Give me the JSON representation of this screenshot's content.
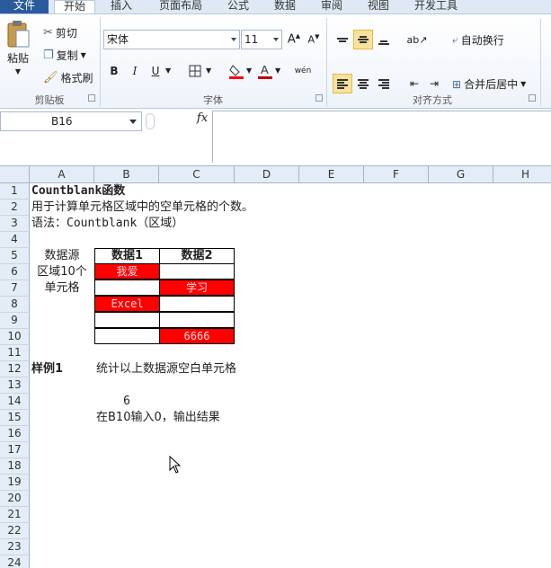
{
  "tabs": [
    "文件",
    "开始",
    "插入",
    "页面布局",
    "公式",
    "数据",
    "审阅",
    "视图",
    "开发工具"
  ],
  "clipboard": {
    "paste": "粘贴",
    "cut": "剪切",
    "copy": "复制",
    "format_painter": "格式刷",
    "group": "剪贴板"
  },
  "font": {
    "name": "宋体",
    "size": "11",
    "bold": "B",
    "italic": "I",
    "underline": "U",
    "group": "字体"
  },
  "alignment": {
    "wrap": "自动换行",
    "merge": "合并后居中",
    "group": "对齐方式"
  },
  "formula_bar": {
    "name_box": "B16",
    "fx": "fx",
    "content": ""
  },
  "columns": [
    "A",
    "B",
    "C",
    "D",
    "E",
    "F",
    "G",
    "H"
  ],
  "rows": [
    "1",
    "2",
    "3",
    "4",
    "5",
    "6",
    "7",
    "8",
    "9",
    "10",
    "11",
    "12",
    "13",
    "14",
    "15",
    "16",
    "17",
    "18",
    "19",
    "20",
    "21",
    "22",
    "23",
    "24"
  ],
  "sheet": {
    "r1": "Countblank函数",
    "r2": "用于计算单元格区域中的空单元格的个数。",
    "r3": "语法：Countblank（区域）",
    "a5": "数据源",
    "a6": "区域10个",
    "a7": "单元格",
    "h1": "数据1",
    "h2": "数据2",
    "b6": "我爱",
    "c7": "学习",
    "b8": "Excel",
    "c10": "6666",
    "a12": "样例1",
    "b12": "统计以上数据源空白单元格",
    "b14": "6",
    "b15": "在B10输入0，输出结果"
  },
  "colors": {
    "accent": "#2a5b9c",
    "fill_red": "#ff0000",
    "header_bg": "#e4ecf7"
  }
}
